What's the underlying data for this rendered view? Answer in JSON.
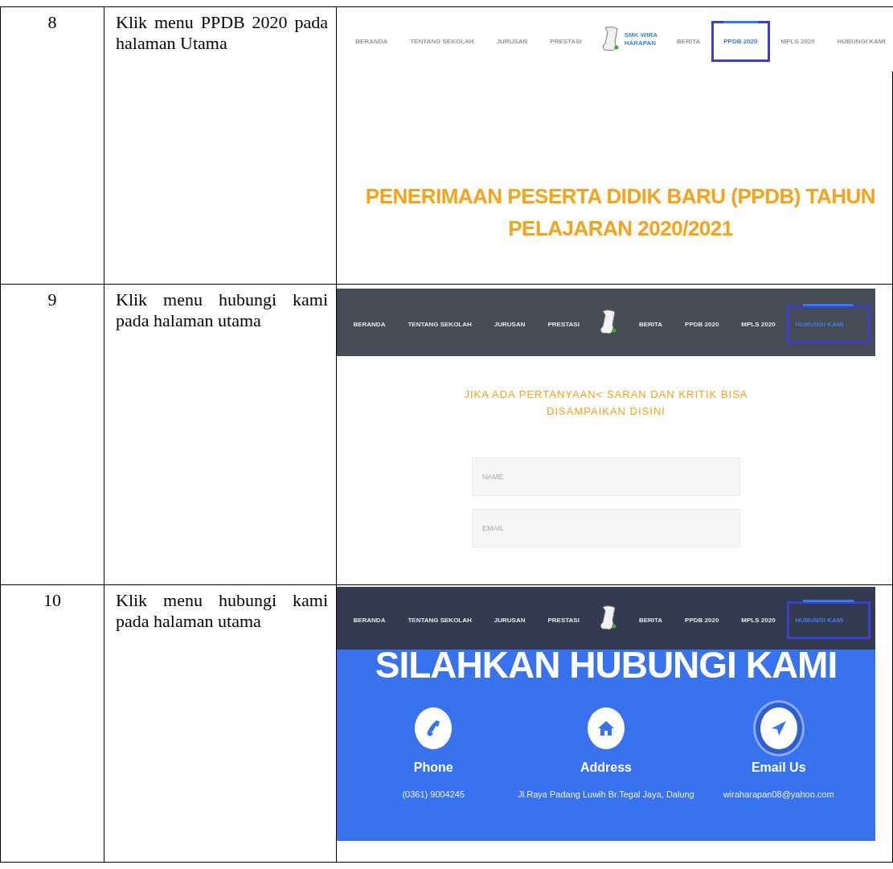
{
  "rows": [
    {
      "number": "8",
      "step": "Klik menu PPDB 2020 pada halaman Utama",
      "screenshot": {
        "kind": "ppdb",
        "nav": {
          "items": [
            {
              "kind": "link",
              "label": "BERANDA",
              "selected": false
            },
            {
              "kind": "link",
              "label": "TENTANG SEKOLAH",
              "selected": false
            },
            {
              "kind": "link",
              "label": "JURUSAN",
              "selected": false
            },
            {
              "kind": "link",
              "label": "PRESTASI",
              "selected": false
            },
            {
              "kind": "logo",
              "lines": [
                "SMK WIRA",
                "HARAPAN"
              ]
            },
            {
              "kind": "link",
              "label": "BERITA",
              "selected": false
            },
            {
              "kind": "link",
              "label": "PPDB 2020",
              "selected": true
            },
            {
              "kind": "link",
              "label": "MPLS 2020",
              "selected": false
            },
            {
              "kind": "link",
              "label": "HUBUNGI KAMI",
              "selected": false
            }
          ]
        },
        "heading_lines": [
          "PENERIMAAN PESERTA DIDIK BARU (PPDB) TAHUN",
          "PELAJARAN 2020/2021"
        ]
      }
    },
    {
      "number": "9",
      "step": "Klik menu hubungi kami pada halaman utama",
      "screenshot": {
        "kind": "form",
        "nav": {
          "items": [
            {
              "kind": "link",
              "label": "BERANDA",
              "selected": false
            },
            {
              "kind": "link",
              "label": "TENTANG SEKOLAH",
              "selected": false
            },
            {
              "kind": "link",
              "label": "JURUSAN",
              "selected": false
            },
            {
              "kind": "link",
              "label": "PRESTASI",
              "selected": false
            },
            {
              "kind": "logo"
            },
            {
              "kind": "link",
              "label": "BERITA",
              "selected": false
            },
            {
              "kind": "link",
              "label": "PPDB 2020",
              "selected": false
            },
            {
              "kind": "link",
              "label": "MPLS 2020",
              "selected": false
            },
            {
              "kind": "link",
              "label": "HUBUNGI KAMI",
              "selected": true
            }
          ]
        },
        "heading_lines": [
          "JIKA ADA PERTANYAAN< SARAN DAN KRITIK BISA",
          "DISAMPAIKAN DISINI"
        ],
        "fields": [
          {
            "placeholder": "NAME"
          },
          {
            "placeholder": "EMAIL"
          }
        ]
      }
    },
    {
      "number": "10",
      "step": "Klik menu hubungi kami pada halaman utama",
      "screenshot": {
        "kind": "contact",
        "nav": {
          "items": [
            {
              "kind": "link",
              "label": "BERANDA",
              "selected": false
            },
            {
              "kind": "link",
              "label": "TENTANG SEKOLAH",
              "selected": false
            },
            {
              "kind": "link",
              "label": "JURUSAN",
              "selected": false
            },
            {
              "kind": "link",
              "label": "PRESTASI",
              "selected": false
            },
            {
              "kind": "logo"
            },
            {
              "kind": "link",
              "label": "BERITA",
              "selected": false
            },
            {
              "kind": "link",
              "label": "PPDB 2020",
              "selected": false
            },
            {
              "kind": "link",
              "label": "MPLS 2020",
              "selected": false
            },
            {
              "kind": "link",
              "label": "HUBUNGI KAMI",
              "selected": true
            }
          ]
        },
        "banner": "SILAHKAN HUBUNGI KAMI",
        "contacts": [
          {
            "kind": "phone",
            "title": "Phone",
            "value": "(0361) 9004245"
          },
          {
            "kind": "address",
            "title": "Address",
            "value": "Jl.Raya Padang Luwih Br.Tegal Jaya, Dalung"
          },
          {
            "kind": "email",
            "title": "Email Us",
            "value": "wiraharapan08@yahoo.com"
          }
        ]
      }
    }
  ]
}
